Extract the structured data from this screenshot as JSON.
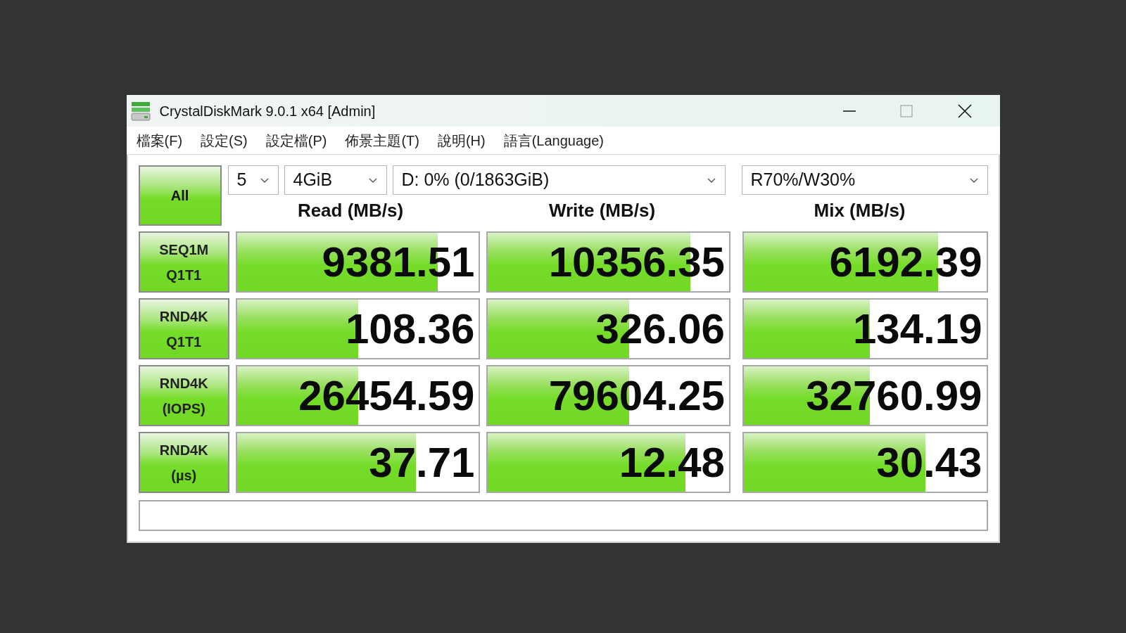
{
  "window": {
    "title": "CrystalDiskMark 9.0.1 x64 [Admin]"
  },
  "menu": [
    "檔案(F)",
    "設定(S)",
    "設定檔(P)",
    "佈景主題(T)",
    "說明(H)",
    "語言(Language)"
  ],
  "all_button": "All",
  "selectors": {
    "count": "5",
    "size": "4GiB",
    "drive": "D: 0% (0/1863GiB)",
    "mix": "R70%/W30%"
  },
  "columns": [
    "Read (MB/s)",
    "Write (MB/s)",
    "Mix (MB/s)"
  ],
  "rows": [
    {
      "label": "SEQ1M\nQ1T1",
      "cells": [
        {
          "value": "9381.51",
          "level": 0.83
        },
        {
          "value": "10356.35",
          "level": 0.84
        },
        {
          "value": "6192.39",
          "level": 0.8
        }
      ]
    },
    {
      "label": "RND4K\nQ1T1",
      "cells": [
        {
          "value": "108.36",
          "level": 0.5
        },
        {
          "value": "326.06",
          "level": 0.585
        },
        {
          "value": "134.19",
          "level": 0.52
        }
      ]
    },
    {
      "label": "RND4K\n(IOPS)",
      "cells": [
        {
          "value": "26454.59",
          "level": 0.5
        },
        {
          "value": "79604.25",
          "level": 0.585
        },
        {
          "value": "32760.99",
          "level": 0.52
        }
      ]
    },
    {
      "label": "RND4K\n(µs)",
      "cells": [
        {
          "value": "37.71",
          "level": 0.74
        },
        {
          "value": "12.48",
          "level": 0.82
        },
        {
          "value": "30.43",
          "level": 0.75
        }
      ]
    }
  ]
}
